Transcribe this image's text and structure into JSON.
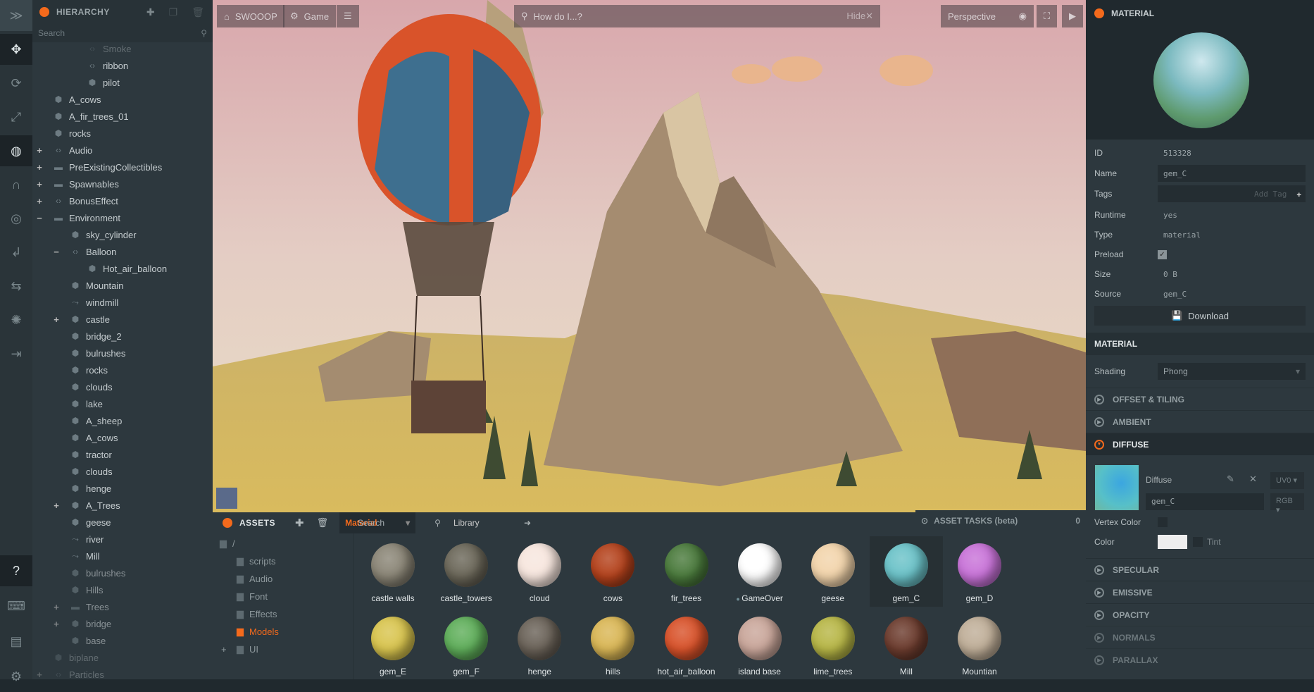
{
  "toolbar": {
    "items": [
      "logo",
      "translate",
      "rotate",
      "scale",
      "world-space",
      "snap",
      "camera-focus",
      "undo",
      "redo",
      "light",
      "export"
    ],
    "bottom": [
      "help",
      "keyboard",
      "chat",
      "settings"
    ]
  },
  "hierarchy": {
    "title": "HIERARCHY",
    "search_placeholder": "Search",
    "items": [
      {
        "label": "Smoke",
        "level": 2,
        "icon": "script",
        "faded": true
      },
      {
        "label": "ribbon",
        "level": 2,
        "icon": "script"
      },
      {
        "label": "pilot",
        "level": 2,
        "icon": "cube"
      },
      {
        "label": "A_cows",
        "level": 0,
        "icon": "cube"
      },
      {
        "label": "A_fir_trees_01",
        "level": 0,
        "icon": "cube"
      },
      {
        "label": "rocks",
        "level": 0,
        "icon": "cube"
      },
      {
        "label": "Audio",
        "level": 0,
        "icon": "script",
        "exp": "+"
      },
      {
        "label": "PreExistingCollectibles",
        "level": 0,
        "icon": "folder",
        "exp": "+"
      },
      {
        "label": "Spawnables",
        "level": 0,
        "icon": "folder",
        "exp": "+"
      },
      {
        "label": "BonusEffect",
        "level": 0,
        "icon": "script",
        "exp": "+"
      },
      {
        "label": "Environment",
        "level": 0,
        "icon": "folder",
        "exp": "−"
      },
      {
        "label": "sky_cylinder",
        "level": 1,
        "icon": "cube"
      },
      {
        "label": "Balloon",
        "level": 1,
        "icon": "script",
        "exp": "−"
      },
      {
        "label": "Hot_air_balloon",
        "level": 2,
        "icon": "cube"
      },
      {
        "label": "Mountain",
        "level": 1,
        "icon": "cube"
      },
      {
        "label": "windmill",
        "level": 1,
        "icon": "anim"
      },
      {
        "label": "castle",
        "level": 1,
        "icon": "cube",
        "exp": "+"
      },
      {
        "label": "bridge_2",
        "level": 1,
        "icon": "cube"
      },
      {
        "label": "bulrushes",
        "level": 1,
        "icon": "cube"
      },
      {
        "label": "rocks",
        "level": 1,
        "icon": "cube"
      },
      {
        "label": "clouds",
        "level": 1,
        "icon": "cube"
      },
      {
        "label": "lake",
        "level": 1,
        "icon": "cube"
      },
      {
        "label": "A_sheep",
        "level": 1,
        "icon": "cube"
      },
      {
        "label": "A_cows",
        "level": 1,
        "icon": "cube"
      },
      {
        "label": "tractor",
        "level": 1,
        "icon": "cube"
      },
      {
        "label": "clouds",
        "level": 1,
        "icon": "cube"
      },
      {
        "label": "henge",
        "level": 1,
        "icon": "cube"
      },
      {
        "label": "A_Trees",
        "level": 1,
        "icon": "cube",
        "exp": "+"
      },
      {
        "label": "geese",
        "level": 1,
        "icon": "cube"
      },
      {
        "label": "river",
        "level": 1,
        "icon": "anim"
      },
      {
        "label": "Mill",
        "level": 1,
        "icon": "anim"
      },
      {
        "label": "bulrushes",
        "level": 1,
        "icon": "cube"
      },
      {
        "label": "Hills",
        "level": 1,
        "icon": "cube"
      },
      {
        "label": "Trees",
        "level": 1,
        "icon": "folder",
        "exp": "+"
      },
      {
        "label": "bridge",
        "level": 1,
        "icon": "cube",
        "exp": "+"
      },
      {
        "label": "base",
        "level": 1,
        "icon": "cube"
      },
      {
        "label": "biplane",
        "level": 0,
        "icon": "cube",
        "faded": true
      },
      {
        "label": "Particles",
        "level": 0,
        "icon": "script",
        "exp": "+",
        "faded": true
      }
    ]
  },
  "viewport": {
    "project": "SWOOOP",
    "scene_settings": "Game",
    "search_placeholder": "How do I...?",
    "hide_label": "Hide",
    "camera": "Perspective"
  },
  "assets": {
    "title": "ASSETS",
    "filter": "Material",
    "search_placeholder": "Search",
    "library": "Library",
    "tree": [
      {
        "label": "/",
        "level": 0
      },
      {
        "label": "scripts",
        "level": 1
      },
      {
        "label": "Audio",
        "level": 1
      },
      {
        "label": "Font",
        "level": 1
      },
      {
        "label": "Effects",
        "level": 1
      },
      {
        "label": "Models",
        "level": 1,
        "active": true
      },
      {
        "label": "UI",
        "level": 1,
        "exp": "+"
      }
    ],
    "items": [
      {
        "name": "castle walls",
        "color": "#8a8576"
      },
      {
        "name": "castle_towers",
        "color": "#6b6759"
      },
      {
        "name": "cloud",
        "color": "#f7e6de"
      },
      {
        "name": "cows",
        "color": "#b4421c"
      },
      {
        "name": "fir_trees",
        "color": "#4a7a3c"
      },
      {
        "name": "GameOver",
        "color": "#ffffff",
        "dot": true
      },
      {
        "name": "geese",
        "color": "#f2d4ab"
      },
      {
        "name": "gem_C",
        "color": "#6bc2c8",
        "selected": true
      },
      {
        "name": "gem_D",
        "color": "#c873d8"
      },
      {
        "name": "gem_E",
        "color": "#d8c44e"
      },
      {
        "name": "gem_F",
        "color": "#5fae5a"
      },
      {
        "name": "henge",
        "color": "#6a6258"
      },
      {
        "name": "hills",
        "color": "#d9b655"
      },
      {
        "name": "hot_air_balloon",
        "color": "#d8522a"
      },
      {
        "name": "island base",
        "color": "#c9a69a"
      },
      {
        "name": "lime_trees",
        "color": "#b7b646"
      },
      {
        "name": "Mill",
        "color": "#6c3c2e"
      },
      {
        "name": "Mountian",
        "color": "#bfae98"
      }
    ],
    "tasks": {
      "title": "ASSET TASKS (beta)",
      "count": "0"
    }
  },
  "inspector": {
    "title": "MATERIAL",
    "id_label": "ID",
    "id": "513328",
    "name_label": "Name",
    "name": "gem_C",
    "tags_label": "Tags",
    "add_tag": "Add Tag",
    "runtime_label": "Runtime",
    "runtime": "yes",
    "type_label": "Type",
    "type": "material",
    "preload_label": "Preload",
    "preload": true,
    "size_label": "Size",
    "size": "0 B",
    "source_label": "Source",
    "source": "gem_C",
    "download": "Download",
    "material_title": "MATERIAL",
    "shading_label": "Shading",
    "shading": "Phong",
    "sections": [
      "OFFSET & TILING",
      "AMBIENT",
      "DIFFUSE",
      "SPECULAR",
      "EMISSIVE",
      "OPACITY",
      "NORMALS",
      "PARALLAX"
    ],
    "diffuse": {
      "label": "Diffuse",
      "texture": "gem_C",
      "uv": "UV0",
      "channel": "RGB",
      "vertex_color_label": "Vertex Color",
      "color_label": "Color",
      "tint_label": "Tint",
      "color": "#eeeeee"
    }
  },
  "accent": "#f46a1c"
}
